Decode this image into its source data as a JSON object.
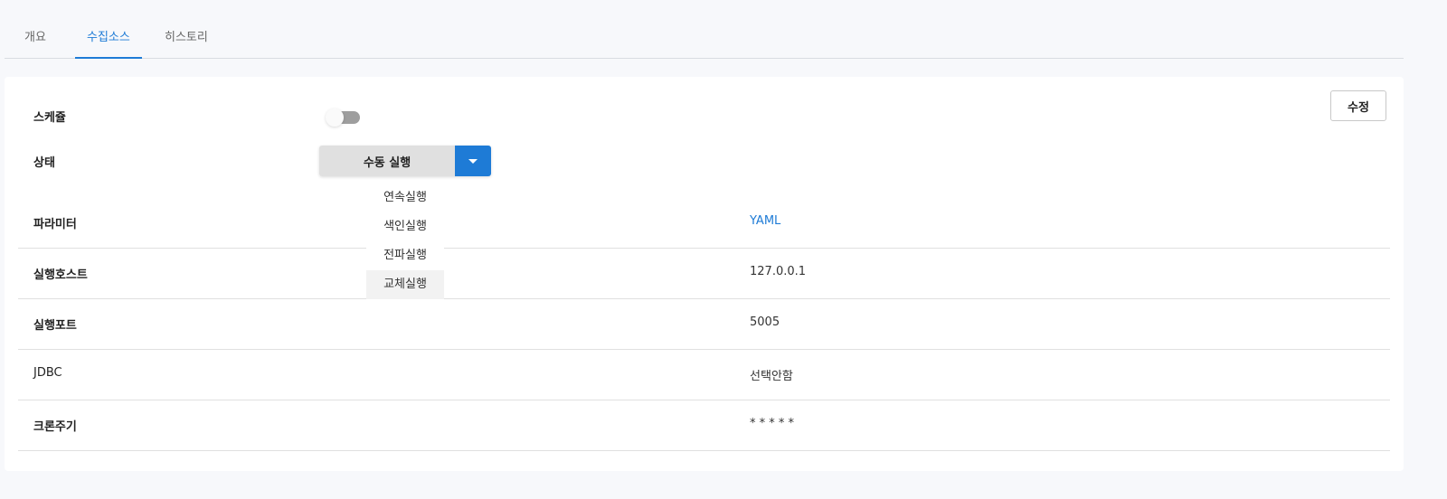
{
  "tabs": [
    {
      "label": "개요"
    },
    {
      "label": "수집소스",
      "active": true
    },
    {
      "label": "히스토리"
    }
  ],
  "edit_label": "수정",
  "schedule": {
    "label": "스케쥴",
    "enabled": false
  },
  "status": {
    "label": "상태",
    "button_label": "수동 실행",
    "menu": [
      "연속실행",
      "색인실행",
      "전파실행",
      "교체실행"
    ],
    "highlighted": "교체실행"
  },
  "fields": [
    {
      "label": "파라미터",
      "value": "YAML"
    },
    {
      "label": "실행호스트",
      "value": "127.0.0.1"
    },
    {
      "label": "실행포트",
      "value": "5005"
    },
    {
      "label": "JDBC",
      "value": "선택안함"
    },
    {
      "label": "크론주기",
      "value": "* * * * *"
    }
  ],
  "colors": {
    "accent": "#1e7bd6",
    "background": "#f7f8fb"
  }
}
